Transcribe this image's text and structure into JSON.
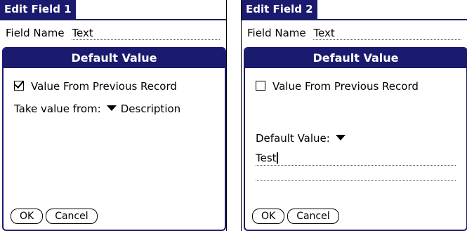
{
  "screen1": {
    "window_title": "Edit Field 1",
    "field_label": "Field Name",
    "field_value": "Text",
    "dialog": {
      "title": "Default Value",
      "checkbox_label": "Value From Previous Record",
      "checkbox_checked": true,
      "take_label": "Take value from:",
      "take_value": "Description",
      "ok_label": "OK",
      "cancel_label": "Cancel"
    }
  },
  "screen2": {
    "window_title": "Edit Field 2",
    "field_label": "Field Name",
    "field_value": "Text",
    "dialog": {
      "title": "Default Value",
      "checkbox_label": "Value From Previous Record",
      "checkbox_checked": false,
      "default_label": "Default Value:",
      "default_text": "Test",
      "ok_label": "OK",
      "cancel_label": "Cancel"
    }
  },
  "colors": {
    "title_bg": "#1a1a6e",
    "title_fg": "#ffffff"
  }
}
